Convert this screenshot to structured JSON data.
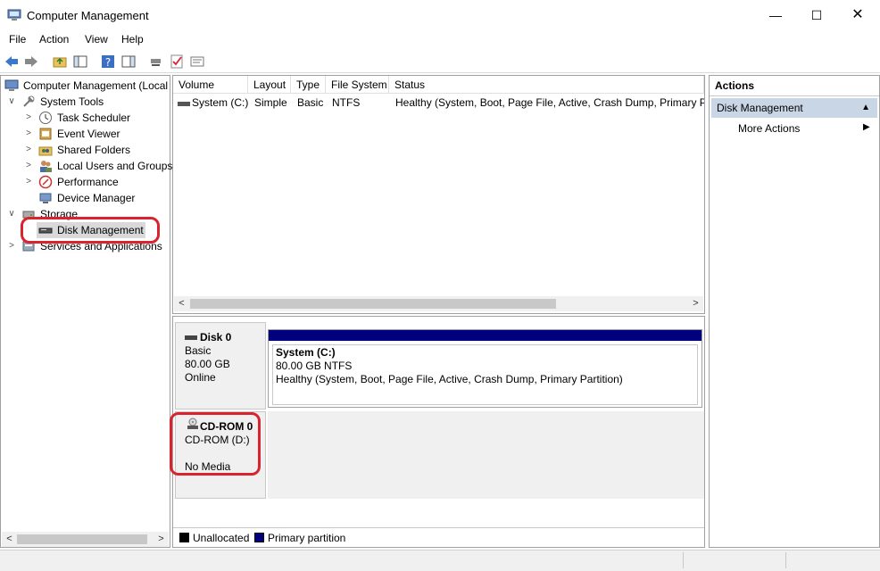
{
  "window": {
    "title": "Computer Management",
    "minimize": "—",
    "maximize": "☐",
    "close": "✕"
  },
  "menu": [
    "File",
    "Action",
    "View",
    "Help"
  ],
  "tree": {
    "root": "Computer Management (Local",
    "items": [
      {
        "label": "System Tools",
        "arrow": "∨"
      },
      {
        "label": "Task Scheduler",
        "arrow": ">"
      },
      {
        "label": "Event Viewer",
        "arrow": ">"
      },
      {
        "label": "Shared Folders",
        "arrow": ">"
      },
      {
        "label": "Local Users and Groups",
        "arrow": ">"
      },
      {
        "label": "Performance",
        "arrow": ">"
      },
      {
        "label": "Device Manager",
        "arrow": ""
      },
      {
        "label": "Storage",
        "arrow": "∨"
      },
      {
        "label": "Disk Management",
        "arrow": ""
      },
      {
        "label": "Services and Applications",
        "arrow": ">"
      }
    ]
  },
  "volumes": {
    "columns": [
      "Volume",
      "Layout",
      "Type",
      "File System",
      "Status"
    ],
    "rows": [
      {
        "volume": "System (C:)",
        "layout": "Simple",
        "type": "Basic",
        "fs": "NTFS",
        "status": "Healthy (System, Boot, Page File, Active, Crash Dump, Primary Pa"
      }
    ]
  },
  "disks": {
    "disk0": {
      "name": "Disk 0",
      "type": "Basic",
      "size": "80.00 GB",
      "state": "Online"
    },
    "partition": {
      "name": "System  (C:)",
      "detail": "80.00 GB NTFS",
      "status": "Healthy (System, Boot, Page File, Active, Crash Dump, Primary Partition)"
    },
    "cdrom": {
      "name": "CD-ROM 0",
      "drive": "CD-ROM (D:)",
      "media": "No Media"
    }
  },
  "legend": {
    "unallocated": "Unallocated",
    "primary": "Primary partition",
    "unallocated_color": "#000000",
    "primary_color": "#00007f"
  },
  "actions": {
    "header": "Actions",
    "section": "Disk Management",
    "more": "More Actions"
  },
  "colors": {
    "highlight": "#d9232e",
    "selection": "#c9d6e6"
  }
}
